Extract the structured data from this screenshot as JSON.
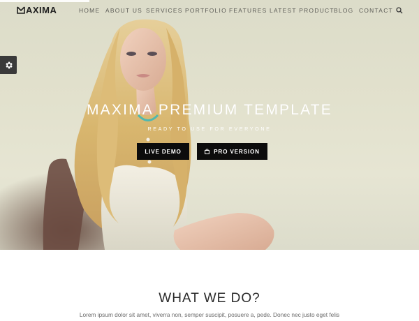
{
  "colors": {
    "accent": "#0c0c0c",
    "hero_bg": "#e2e1cd",
    "hair": "#d9b56b"
  },
  "brand": {
    "logo_text": "AXIMA"
  },
  "nav": {
    "items": [
      "HOME",
      "ABOUT US",
      "SERVICES",
      "PORTFOLIO",
      "FEATURES",
      "LATEST PRODUCT",
      "BLOG",
      "CONTACT"
    ],
    "search_icon": "search-icon"
  },
  "settings": {
    "icon": "gear-icon"
  },
  "hero": {
    "title": "MAXIMA PREMIUM TEMPLATE",
    "subtitle": "READY TO USE FOR EVERYONE",
    "live_demo_label": "LIVE DEMO",
    "pro_version_label": "PRO VERSION",
    "pro_icon": "shopping-bag-icon"
  },
  "section": {
    "title": "WHAT WE DO?",
    "text": "Lorem ipsum dolor sit amet, viverra non, semper suscipit, posuere a, pede. Donec nec justo eget felis"
  }
}
